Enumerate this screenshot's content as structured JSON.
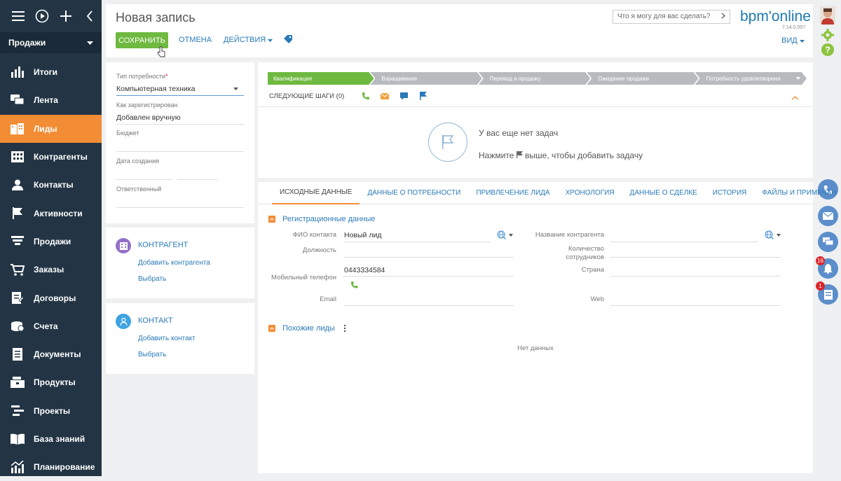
{
  "sidebar": {
    "workplace": "Продажи",
    "items": [
      {
        "label": "Итоги",
        "icon": "bar-chart-icon",
        "active": false
      },
      {
        "label": "Лента",
        "icon": "chat-icon",
        "active": false
      },
      {
        "label": "Лиды",
        "icon": "leads-icon",
        "active": true
      },
      {
        "label": "Контрагенты",
        "icon": "building-icon",
        "active": false
      },
      {
        "label": "Контакты",
        "icon": "person-icon",
        "active": false
      },
      {
        "label": "Активности",
        "icon": "flag-icon",
        "active": false
      },
      {
        "label": "Продажи",
        "icon": "funnel-icon",
        "active": false
      },
      {
        "label": "Заказы",
        "icon": "cart-icon",
        "active": false
      },
      {
        "label": "Договоры",
        "icon": "contract-icon",
        "active": false
      },
      {
        "label": "Счета",
        "icon": "invoice-icon",
        "active": false
      },
      {
        "label": "Документы",
        "icon": "document-icon",
        "active": false
      },
      {
        "label": "Продукты",
        "icon": "product-icon",
        "active": false
      },
      {
        "label": "Проекты",
        "icon": "project-icon",
        "active": false
      },
      {
        "label": "База знаний",
        "icon": "book-icon",
        "active": false
      },
      {
        "label": "Планирование",
        "icon": "planning-icon",
        "active": false
      }
    ]
  },
  "header": {
    "title": "Новая запись",
    "save": "СОХРАНИТЬ",
    "cancel": "ОТМЕНА",
    "actions": "ДЕЙСТВИЯ",
    "search_placeholder": "Что я могу для вас сделать?",
    "logo": "bpm'online",
    "version": "7.14.0.597",
    "view": "ВИД"
  },
  "lead_form": {
    "need_type_label": "Тип потребности",
    "need_type_value": "Компьютерная техника",
    "registered_label": "Как зарегистрирован",
    "registered_value": "Добавлен вручную",
    "budget_label": "Бюджет",
    "created_label": "Дата создания",
    "owner_label": "Ответственный"
  },
  "account_section": {
    "title": "КОНТРАГЕНТ",
    "add": "Добавить контрагента",
    "select": "Выбрать"
  },
  "contact_section": {
    "title": "КОНТАКТ",
    "add": "Добавить контакт",
    "select": "Выбрать"
  },
  "stages": [
    "Квалификация",
    "Взращивание",
    "Перевод в продажу",
    "Ожидание продажи",
    "Потребность удовлетворена"
  ],
  "next_steps": {
    "label": "СЛЕДУЮЩИЕ ШАГИ (0)",
    "empty_title": "У вас еще нет задач",
    "empty_hint_before": "Нажмите",
    "empty_hint_after": "выше, чтобы добавить задачу"
  },
  "tabs": [
    "ИСХОДНЫЕ ДАННЫЕ",
    "ДАННЫЕ О ПОТРЕБНОСТИ",
    "ПРИВЛЕЧЕНИЕ ЛИДА",
    "ХРОНОЛОГИЯ",
    "ДАННЫЕ О СДЕЛКЕ",
    "ИСТОРИЯ",
    "ФАЙЛЫ И ПРИМЕЧАН"
  ],
  "registration": {
    "title": "Регистрационные данные",
    "contact_name_label": "ФИО контакта",
    "contact_name_value": "Новый лид",
    "job_label": "Должность",
    "mobile_label": "Мобильный телефон",
    "mobile_value": "0443334584",
    "email_label": "Email",
    "account_name_label": "Название контрагента",
    "employees_label_1": "Количество",
    "employees_label_2": "сотрудников",
    "country_label": "Страна",
    "web_label": "Web"
  },
  "similar": {
    "title": "Похожие лиды",
    "empty": "Нет данных"
  },
  "notifications": {
    "bell_count": "16",
    "tasks_count": "1"
  },
  "colors": {
    "sidebar": "#233545",
    "accent": "#f28d35",
    "save": "#6fb940",
    "link": "#2a7ab7"
  }
}
